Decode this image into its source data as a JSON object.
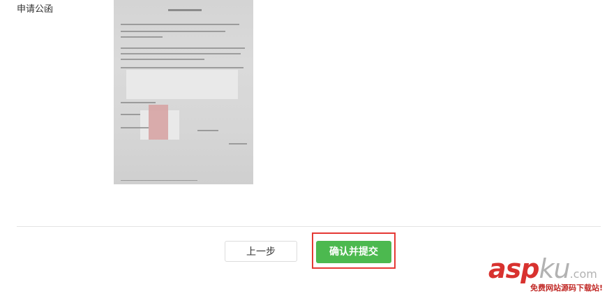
{
  "form": {
    "field_label": "申请公函"
  },
  "actions": {
    "prev_label": "上一步",
    "submit_label": "确认并提交"
  },
  "watermark": {
    "logo_asp": "asp",
    "logo_ku": "ku",
    "logo_suffix": ".com",
    "slogan": "免费网站源码下载站!"
  },
  "colors": {
    "submit_bg": "#4cb94f",
    "highlight": "#e53935",
    "watermark_red": "#d8322f"
  }
}
